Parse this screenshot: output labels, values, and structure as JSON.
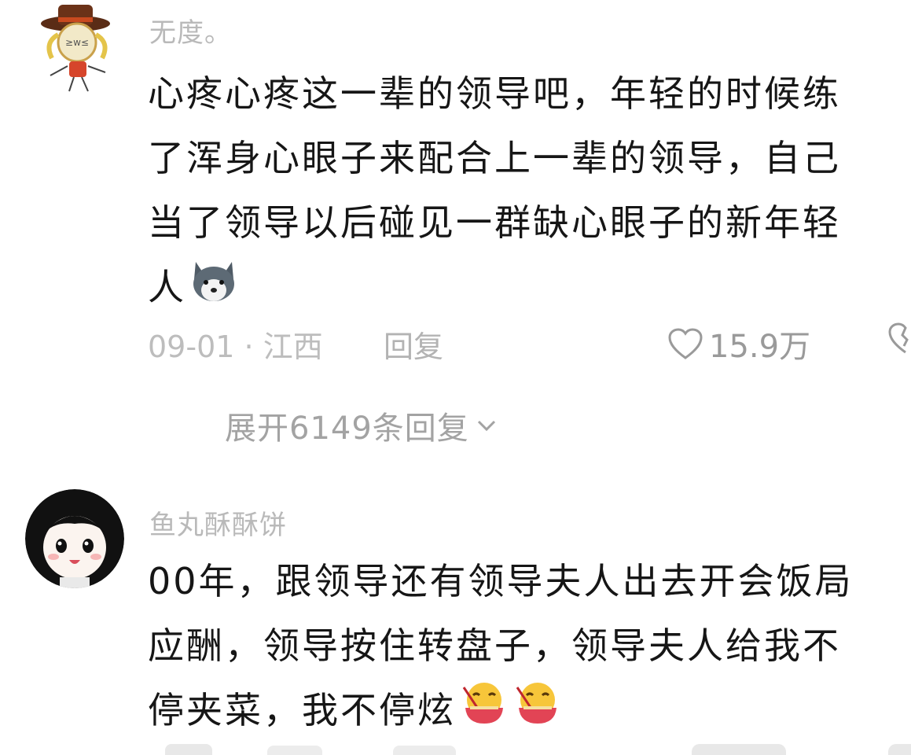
{
  "comments": [
    {
      "username": "无度。",
      "lines": [
        "心疼心疼这一辈的领导吧，年轻的时候练",
        "了浑身心眼子来配合上一辈的领导，自己",
        "当了领导以后碰见一群缺心眼子的新年轻",
        "人"
      ],
      "date": "09-01",
      "location": "江西",
      "reply_label": "回复",
      "likes": "15.9万",
      "expand_label": "展开6149条回复",
      "emoji": [
        "husky-emoji"
      ],
      "avatar": "cowboy-hat-character-avatar"
    },
    {
      "username": "鱼丸酥酥饼",
      "lines": [
        "00年，跟领导还有领导夫人出去开会饭局",
        "应酬，领导按住转盘子，领导夫人给我不",
        "停夹菜，我不停炫"
      ],
      "emoji": [
        "eating-emoji",
        "eating-emoji"
      ],
      "avatar": "anime-girl-avatar"
    }
  ],
  "icons": {
    "like": "heart-outline-icon",
    "dislike": "broken-heart-icon",
    "expand": "chevron-down-icon"
  },
  "colors": {
    "text": "#161616",
    "meta": "#bdbdbd",
    "username": "#b9b9b9"
  }
}
